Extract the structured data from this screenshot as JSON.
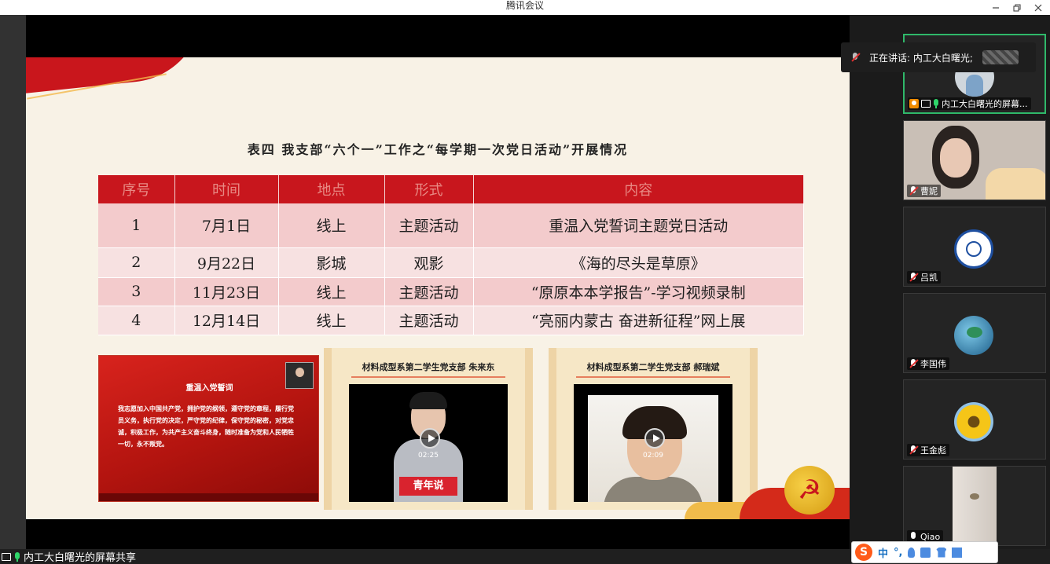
{
  "window": {
    "title": "腾讯会议",
    "controls": [
      "minimize",
      "maximize",
      "close"
    ]
  },
  "slide": {
    "table_title": "表四  我支部“六个一”工作之“每学期一次党日活动”开展情况",
    "headers": [
      "序号",
      "时间",
      "地点",
      "形式",
      "内容"
    ],
    "rows": [
      [
        "1",
        "7月1日",
        "线上",
        "主题活动",
        "重温入党誓词主题党日活动"
      ],
      [
        "2",
        "9月22日",
        "影城",
        "观影",
        "《海的尽头是草原》"
      ],
      [
        "3",
        "11月23日",
        "线上",
        "主题活动",
        "“原原本本学报告”-学习视频录制"
      ],
      [
        "4",
        "12月14日",
        "线上",
        "主题活动",
        "“亮丽内蒙古  奋进新征程”网上展"
      ]
    ],
    "thumb_oath": {
      "title": "重温入党誓词",
      "body": "我志愿加入中国共产党，拥护党的纲领，遵守党的章程，履行党员义务，执行党的决定，严守党的纪律，保守党的秘密，对党忠诚，积极工作，为共产主义奋斗终身，随时准备为党和人民牺牲一切，永不叛党。"
    },
    "video1": {
      "title": "材料成型系第二学生党支部 朱来东",
      "duration": "02:25",
      "tag": "青年说"
    },
    "video2": {
      "title": "材料成型系第二学生党支部 郝瑞斌",
      "duration": "02:09"
    },
    "emblem_icon": "party-emblem-icon"
  },
  "speaking": {
    "text": "正在讲话: 内工大白曙光;"
  },
  "participants": [
    {
      "name": "内工大白曙光的屏幕...",
      "active": true,
      "mic": "on"
    },
    {
      "name": "曹妮",
      "active": false,
      "mic": "muted"
    },
    {
      "name": "吕凯",
      "active": false,
      "mic": "muted"
    },
    {
      "name": "李国伟",
      "active": false,
      "mic": "muted"
    },
    {
      "name": "王金彪",
      "active": false,
      "mic": "muted"
    },
    {
      "name": "Qiao",
      "active": false,
      "mic": "on-white"
    }
  ],
  "bottom": {
    "share_label": "内工大白曙光的屏幕共享"
  },
  "ime": {
    "logo": "S",
    "mode": "中",
    "punct": "°,"
  },
  "colors": {
    "table_header": "#c8161d",
    "active_border": "#2fb86a",
    "mic_on": "#2fd66a",
    "mic_muted_slash": "#e03131"
  }
}
